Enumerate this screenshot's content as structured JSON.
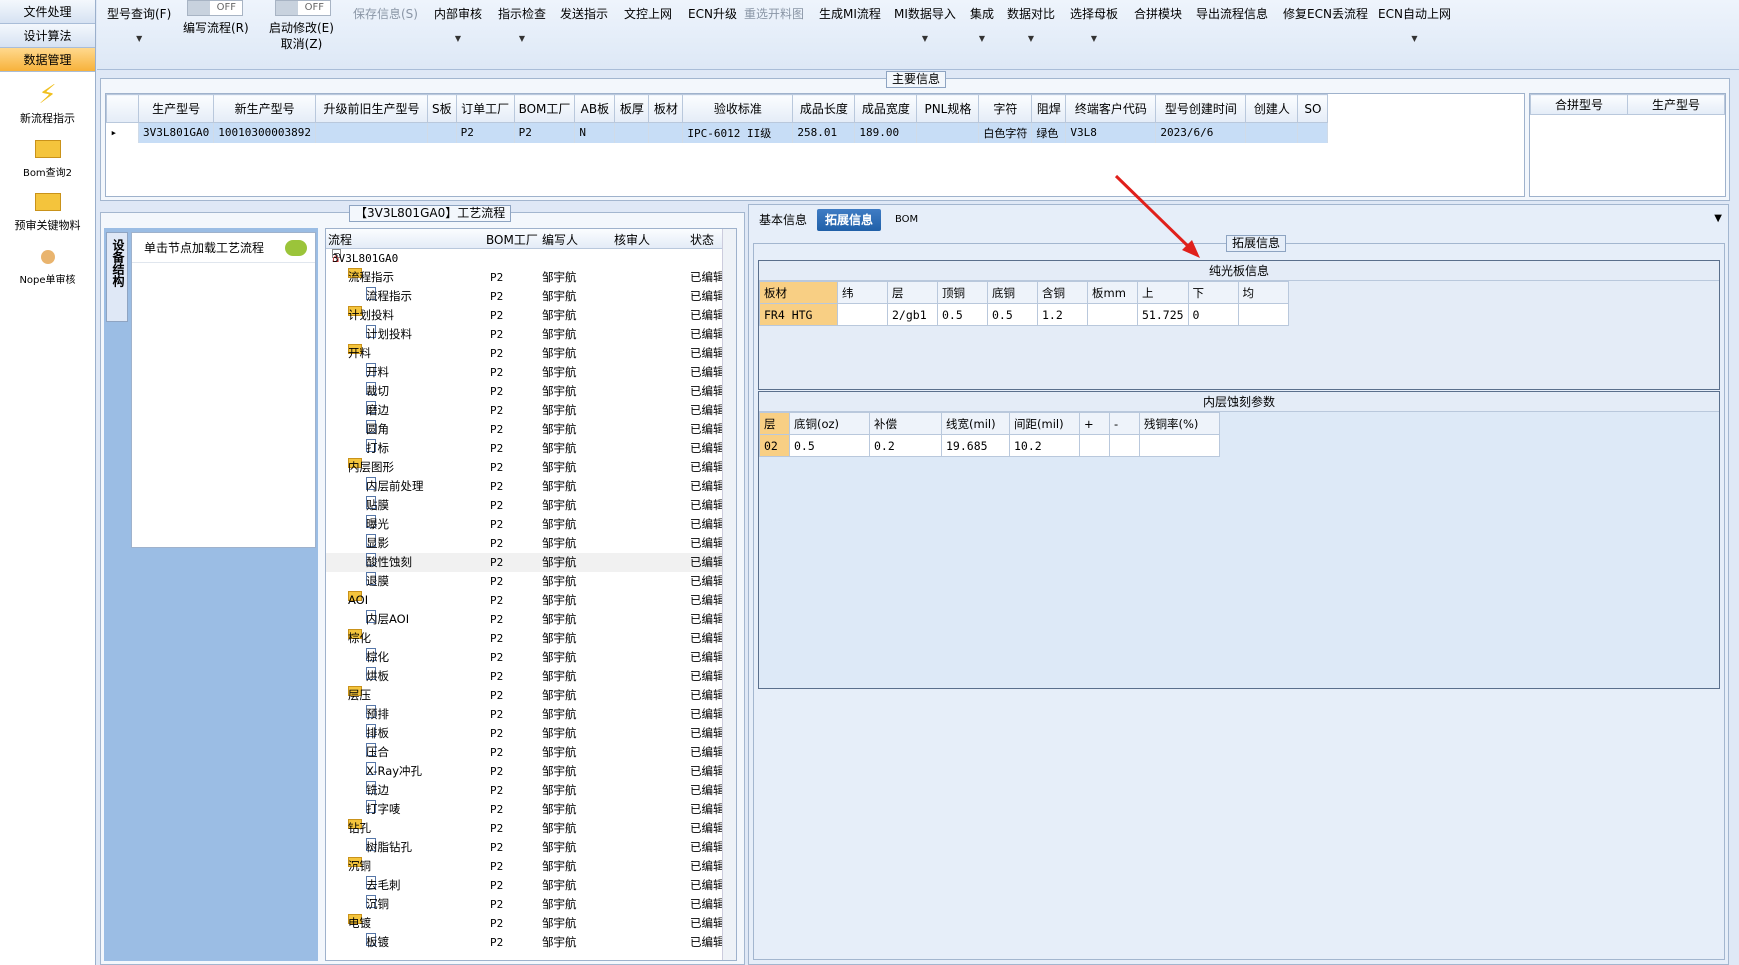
{
  "nav": {
    "tabs": [
      "文件处理",
      "设计算法",
      "数据管理"
    ],
    "tools": [
      {
        "label": "新流程指示",
        "icon": "lightning-icon"
      },
      {
        "label": "Bom查询2",
        "icon": "folder-icon"
      },
      {
        "label": "预审关键物料",
        "icon": "folder-icon"
      },
      {
        "label": "Nope单审核",
        "icon": "user-icon"
      }
    ]
  },
  "toolbar": {
    "query": "型号查询(F)",
    "toggle1": "OFF",
    "edit_flow": "编写流程(R)",
    "toggle2": "OFF",
    "start_edit": "启动修改(E)",
    "cancel": "取消(Z)",
    "items": [
      "保存信息(S)",
      "内部审核",
      "指示检查",
      "发送指示",
      "文控上网",
      "ECN升级",
      "重选开料图",
      "生成MI流程",
      "MI数据导入",
      "集成",
      "数据对比",
      "选择母板",
      "合拼模块",
      "导出流程信息",
      "修复ECN丢流程",
      "ECN自动上网"
    ]
  },
  "main": {
    "title": "主要信息",
    "columns": [
      "生产型号",
      "新生产型号",
      "升级前旧生产型号",
      "S板",
      "订单工厂",
      "BOM工厂",
      "AB板",
      "板厚",
      "板材",
      "验收标准",
      "成品长度",
      "成品宽度",
      "PNL规格",
      "字符",
      "阻焊",
      "终端客户代码",
      "型号创建时间",
      "创建人",
      "SO"
    ],
    "row": [
      "3V3L801GA0",
      "10010300003892",
      "",
      "",
      "P2",
      "P2",
      "N",
      "",
      "",
      "IPC-6012 II级",
      "258.01",
      "189.00",
      "",
      "白色字符",
      "绿色",
      "V3L8",
      "2023/6/6",
      "",
      ""
    ],
    "side_columns": [
      "合拼型号",
      "生产型号"
    ]
  },
  "process": {
    "title": "【3V3L801GA0】工艺流程",
    "vtab": "设备结构",
    "load_hint": "单击节点加载工艺流程",
    "columns": [
      "流程",
      "BOM工厂",
      "编写人",
      "核审人",
      "状态"
    ],
    "root": "3V3L801GA0",
    "rows": [
      {
        "name": "流程指示",
        "lvl": 1,
        "type": "folder",
        "f": "P2",
        "w": "邹宇航",
        "s": "已编辑"
      },
      {
        "name": "流程指示",
        "lvl": 2,
        "type": "doc",
        "f": "P2",
        "w": "邹宇航",
        "s": "已编辑"
      },
      {
        "name": "计划投料",
        "lvl": 1,
        "type": "folder",
        "f": "P2",
        "w": "邹宇航",
        "s": "已编辑"
      },
      {
        "name": "计划投料",
        "lvl": 2,
        "type": "doc",
        "f": "P2",
        "w": "邹宇航",
        "s": "已编辑"
      },
      {
        "name": "开料",
        "lvl": 1,
        "type": "folder",
        "f": "P2",
        "w": "邹宇航",
        "s": "已编辑"
      },
      {
        "name": "开料",
        "lvl": 2,
        "type": "doc",
        "f": "P2",
        "w": "邹宇航",
        "s": "已编辑"
      },
      {
        "name": "裁切",
        "lvl": 2,
        "type": "doc",
        "f": "P2",
        "w": "邹宇航",
        "s": "已编辑"
      },
      {
        "name": "磨边",
        "lvl": 2,
        "type": "doc",
        "f": "P2",
        "w": "邹宇航",
        "s": "已编辑"
      },
      {
        "name": "圆角",
        "lvl": 2,
        "type": "doc",
        "f": "P2",
        "w": "邹宇航",
        "s": "已编辑"
      },
      {
        "name": "打标",
        "lvl": 2,
        "type": "doc",
        "f": "P2",
        "w": "邹宇航",
        "s": "已编辑"
      },
      {
        "name": "内层图形",
        "lvl": 1,
        "type": "folder",
        "f": "P2",
        "w": "邹宇航",
        "s": "已编辑"
      },
      {
        "name": "内层前处理",
        "lvl": 2,
        "type": "doc",
        "f": "P2",
        "w": "邹宇航",
        "s": "已编辑"
      },
      {
        "name": "贴膜",
        "lvl": 2,
        "type": "doc",
        "f": "P2",
        "w": "邹宇航",
        "s": "已编辑"
      },
      {
        "name": "曝光",
        "lvl": 2,
        "type": "doc",
        "f": "P2",
        "w": "邹宇航",
        "s": "已编辑"
      },
      {
        "name": "显影",
        "lvl": 2,
        "type": "doc",
        "f": "P2",
        "w": "邹宇航",
        "s": "已编辑"
      },
      {
        "name": "酸性蚀刻",
        "lvl": 2,
        "type": "doc",
        "f": "P2",
        "w": "邹宇航",
        "s": "已编辑",
        "sel": true
      },
      {
        "name": "退膜",
        "lvl": 2,
        "type": "doc",
        "f": "P2",
        "w": "邹宇航",
        "s": "已编辑"
      },
      {
        "name": "AOI",
        "lvl": 1,
        "type": "folder",
        "f": "P2",
        "w": "邹宇航",
        "s": "已编辑"
      },
      {
        "name": "内层AOI",
        "lvl": 2,
        "type": "doc",
        "f": "P2",
        "w": "邹宇航",
        "s": "已编辑"
      },
      {
        "name": "棕化",
        "lvl": 1,
        "type": "folder",
        "f": "P2",
        "w": "邹宇航",
        "s": "已编辑"
      },
      {
        "name": "棕化",
        "lvl": 2,
        "type": "doc",
        "f": "P2",
        "w": "邹宇航",
        "s": "已编辑"
      },
      {
        "name": "烘板",
        "lvl": 2,
        "type": "doc",
        "f": "P2",
        "w": "邹宇航",
        "s": "已编辑"
      },
      {
        "name": "层压",
        "lvl": 1,
        "type": "folder",
        "f": "P2",
        "w": "邹宇航",
        "s": "已编辑"
      },
      {
        "name": "预排",
        "lvl": 2,
        "type": "doc",
        "f": "P2",
        "w": "邹宇航",
        "s": "已编辑"
      },
      {
        "name": "排板",
        "lvl": 2,
        "type": "doc",
        "f": "P2",
        "w": "邹宇航",
        "s": "已编辑"
      },
      {
        "name": "压合",
        "lvl": 2,
        "type": "doc",
        "f": "P2",
        "w": "邹宇航",
        "s": "已编辑"
      },
      {
        "name": "X-Ray冲孔",
        "lvl": 2,
        "type": "doc",
        "f": "P2",
        "w": "邹宇航",
        "s": "已编辑"
      },
      {
        "name": "铣边",
        "lvl": 2,
        "type": "doc",
        "f": "P2",
        "w": "邹宇航",
        "s": "已编辑"
      },
      {
        "name": "打字唛",
        "lvl": 2,
        "type": "doc",
        "f": "P2",
        "w": "邹宇航",
        "s": "已编辑"
      },
      {
        "name": "钻孔",
        "lvl": 1,
        "type": "folder",
        "f": "P2",
        "w": "邹宇航",
        "s": "已编辑"
      },
      {
        "name": "树脂钻孔",
        "lvl": 2,
        "type": "doc",
        "f": "P2",
        "w": "邹宇航",
        "s": "已编辑"
      },
      {
        "name": "沉铜",
        "lvl": 1,
        "type": "folder",
        "f": "P2",
        "w": "邹宇航",
        "s": "已编辑"
      },
      {
        "name": "去毛刺",
        "lvl": 2,
        "type": "doc",
        "f": "P2",
        "w": "邹宇航",
        "s": "已编辑"
      },
      {
        "name": "沉铜",
        "lvl": 2,
        "type": "doc",
        "f": "P2",
        "w": "邹宇航",
        "s": "已编辑"
      },
      {
        "name": "电镀",
        "lvl": 1,
        "type": "folder",
        "f": "P2",
        "w": "邹宇航",
        "s": "已编辑"
      },
      {
        "name": "板镀",
        "lvl": 2,
        "type": "doc",
        "f": "P2",
        "w": "邹宇航",
        "s": "已编辑"
      }
    ]
  },
  "right": {
    "tabs": [
      "基本信息",
      "拓展信息",
      "BOM"
    ],
    "active": "拓展信息",
    "group_title": "拓展信息",
    "bare": {
      "title": "纯光板信息",
      "columns": [
        "板材",
        "纬",
        "层",
        "顶铜",
        "底铜",
        "含铜",
        "板mm",
        "上",
        "下",
        "均"
      ],
      "row": [
        "FR4 HTG",
        "",
        "2/gb1",
        "0.5",
        "0.5",
        "1.2",
        "",
        "51.725",
        "0",
        ""
      ]
    },
    "etch": {
      "title": "内层蚀刻参数",
      "columns": [
        "层",
        "底铜(oz)",
        "补偿",
        "线宽(mil)",
        "间距(mil)",
        "+",
        "-",
        "残铜率(%)"
      ],
      "row": [
        "02",
        "0.5",
        "0.2",
        "19.685",
        "10.2",
        "",
        "",
        ""
      ]
    }
  },
  "colors": {
    "highlight": "#f8cf84",
    "selected_row": "#c7ddf6",
    "arrow": "#e0201b",
    "active_tab": "#2a6ab4"
  }
}
